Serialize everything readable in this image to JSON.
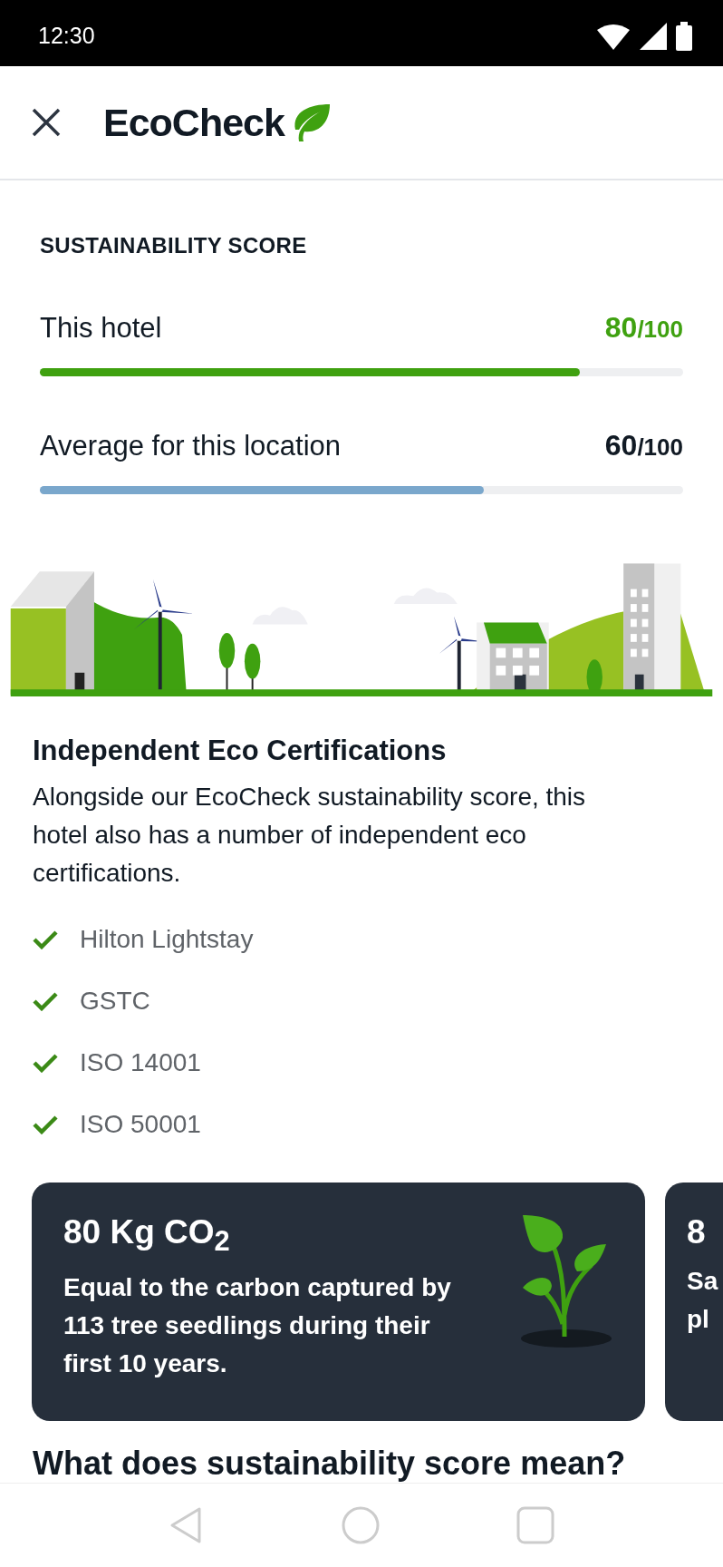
{
  "status_bar": {
    "time": "12:30"
  },
  "header": {
    "logo": "EcoCheck"
  },
  "score": {
    "title": "SUSTAINABILITY SCORE",
    "rows": [
      {
        "label": "This hotel",
        "value": "80",
        "total": "/100",
        "kind": "hotel",
        "level": 0.84
      },
      {
        "label": "Average for this location",
        "value": "60",
        "total": "/100",
        "kind": "average",
        "level": 0.69
      }
    ]
  },
  "certifications": {
    "title": "Independent Eco Certifications",
    "intro": "Alongside our EcoCheck sustainability score, this hotel also has a number of independent eco certifications.",
    "items": [
      "Hilton Lightstay",
      "GSTC",
      "ISO 14001",
      "ISO 50001"
    ]
  },
  "cards": [
    {
      "title": "80 Kg CO$_{2}$",
      "lines": [
        "Equal to the carbon captured by",
        "113 tree seedlings during their",
        "first 10 years."
      ]
    },
    {
      "title": "8",
      "lines": [
        "Sa",
        "pl"
      ]
    }
  ],
  "next_heading": "What does sustainability score mean?"
}
